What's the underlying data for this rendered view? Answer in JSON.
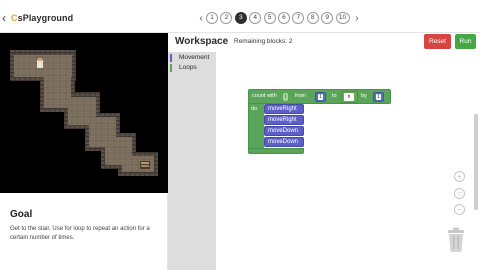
{
  "header": {
    "back_chevron": "‹",
    "logo_c": "C",
    "logo_rest": "sPlayground",
    "prev_arrow": "‹",
    "next_arrow": "›",
    "levels": [
      "1",
      "2",
      "3",
      "4",
      "5",
      "6",
      "7",
      "8",
      "9",
      "10"
    ],
    "active_level": "3"
  },
  "workspace": {
    "title": "Workspace",
    "remaining": "Remaining blocks: 2",
    "reset_label": "Reset",
    "run_label": "Run"
  },
  "toolbox": {
    "categories": [
      {
        "label": "Movement",
        "color": "#5b5fc7"
      },
      {
        "label": "Loops",
        "color": "#5ba55b"
      }
    ]
  },
  "blocks": {
    "loop": {
      "count_with": "count with",
      "var": "i",
      "from": "from",
      "from_val": "1",
      "to": "to",
      "to_var": "n",
      "by": "by",
      "by_val": "1",
      "do": "do"
    },
    "moves": [
      "moveRight",
      "moveRight",
      "moveDown",
      "moveDown"
    ]
  },
  "goal": {
    "title": "Goal",
    "text": "Get to the stair. Use for loop to repeat an action for a certain number of times."
  },
  "zoom": {
    "plus": "+",
    "reset": "○",
    "minus": "−"
  },
  "colors": {
    "reset": "#d64541",
    "run": "#45a845",
    "loop_block": "#5ba55b",
    "move_block": "#5b5fc7",
    "number_block": "#4f73b6"
  }
}
